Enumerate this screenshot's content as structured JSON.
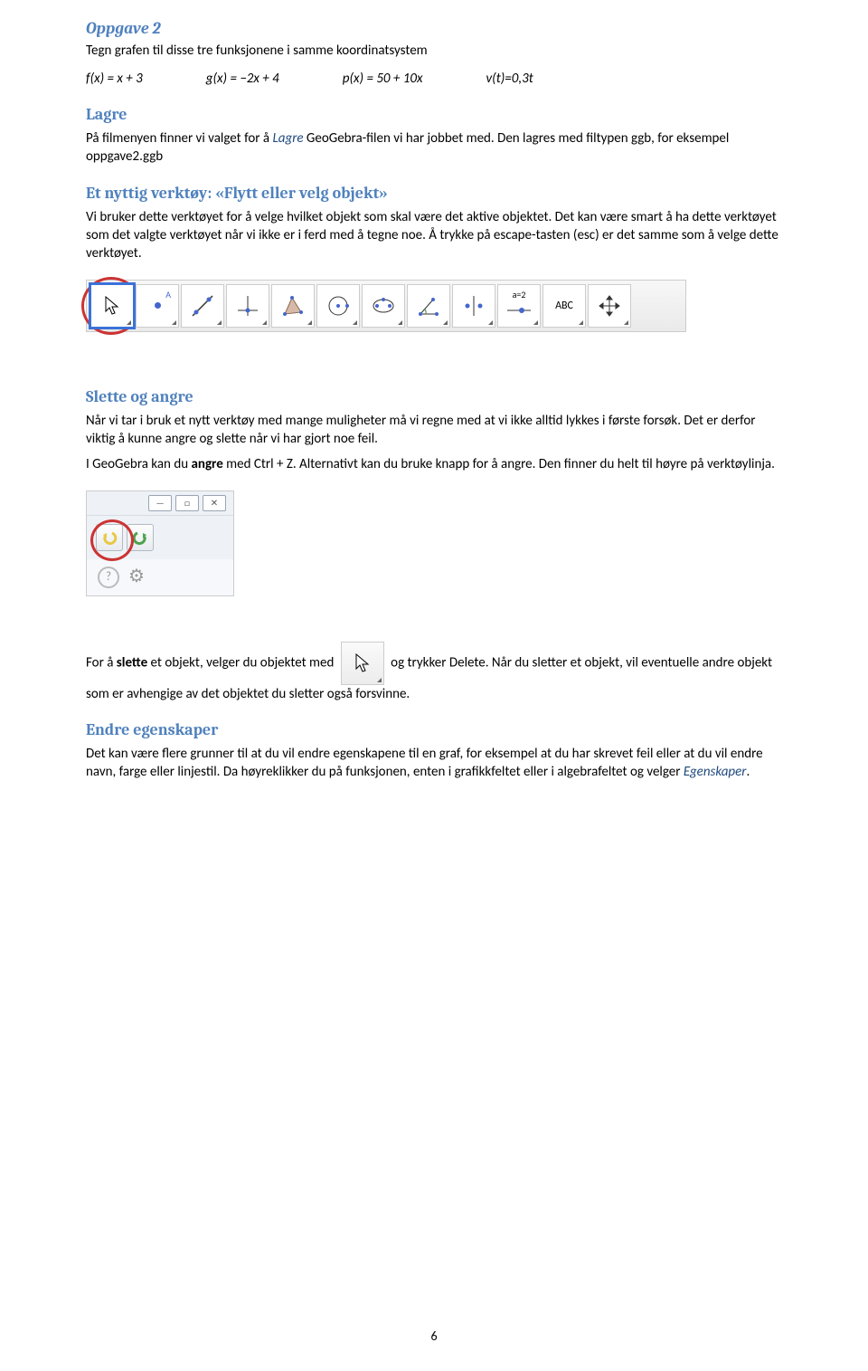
{
  "oppgave2": {
    "title": "Oppgave 2",
    "intro": "Tegn grafen til disse tre funksjonene i samme koordinatsystem",
    "f": "f(x) = x + 3",
    "g": "g(x) = −2x + 4",
    "p": "p(x) = 50 + 10x",
    "v": "v(t)=0,3t"
  },
  "lagre": {
    "title": "Lagre",
    "p1_a": "På filmenyen finner vi valget for å ",
    "p1_lagre": "Lagre",
    "p1_b": " GeoGebra-filen vi har jobbet med. Den lagres med filtypen ggb, for eksempel oppgave2.ggb"
  },
  "verktoy": {
    "title": "Et nyttig verktøy: «Flytt eller velg objekt»",
    "p1": "Vi bruker dette verktøyet for å velge hvilket objekt som skal være det aktive objektet. Det kan være smart å ha dette verktøyet som det valgte verktøyet når vi ikke er i ferd med å tegne noe. Å trykke på escape-tasten (esc) er det samme som å velge dette verktøyet."
  },
  "toolbar": {
    "pointer": "↖",
    "point": "•A",
    "line": "⁄",
    "perp": "⊥",
    "poly": "▷",
    "circle": "◯",
    "ellipse": "⬭",
    "angle": "∡",
    "reflect": "•|•",
    "slider": "a=2",
    "text": "ABC",
    "move": "✥"
  },
  "slette": {
    "title": "Slette og angre",
    "p1": "Når vi tar i bruk et nytt verktøy med mange muligheter må vi regne med at vi ikke alltid lykkes i første forsøk. Det er derfor viktig å kunne angre og slette når vi har gjort noe feil.",
    "p2_a": "I GeoGebra kan du ",
    "p2_b": "angre",
    "p2_c": " med Ctrl + Z. Alternativt kan du bruke knapp for å angre. Den finner du helt til høyre på verktøylinja.",
    "p3_a": "For å ",
    "p3_b": "slette",
    "p3_c": " et objekt, velger du objektet med ",
    "p3_d": " og trykker Delete. Når du sletter et objekt, vil eventuelle andre objekt som er avhengige av det objektet du sletter også forsvinne."
  },
  "undoicons": {
    "min": "—",
    "max": "□",
    "close": "✕",
    "undo": "↶",
    "redo": "↷",
    "help": "?",
    "gear": "⚙"
  },
  "endre": {
    "title": "Endre egenskaper",
    "p1_a": "Det kan være flere grunner til at du vil endre egenskapene til en graf, for eksempel at du har skrevet feil eller at du vil endre navn, farge eller linjestil. Da høyreklikker du på funksjonen, enten i grafikkfeltet eller i algebrafeltet og velger ",
    "p1_term": "Egenskaper",
    "p1_b": "."
  },
  "page": {
    "num": "6"
  }
}
